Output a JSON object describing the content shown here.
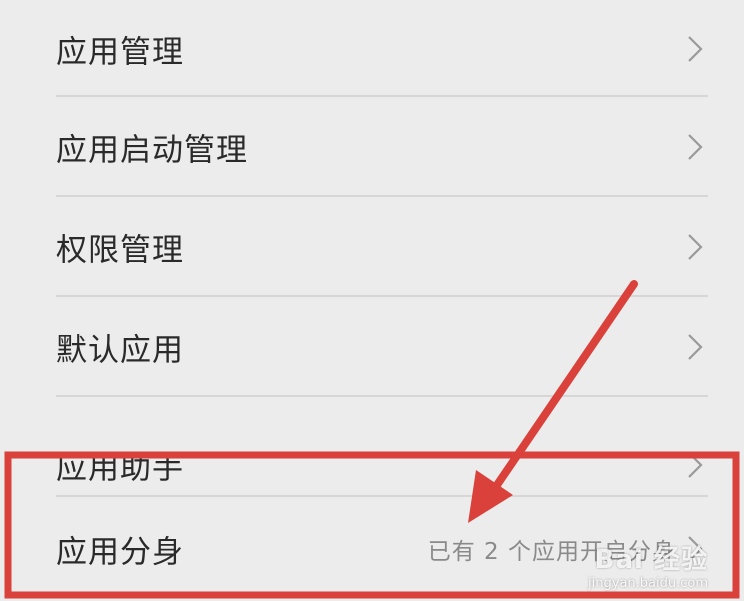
{
  "settings_list": {
    "items": [
      {
        "label": "应用管理",
        "value": ""
      },
      {
        "label": "应用启动管理",
        "value": ""
      },
      {
        "label": "权限管理",
        "value": ""
      },
      {
        "label": "默认应用",
        "value": ""
      },
      {
        "label": "应用助手",
        "value": ""
      },
      {
        "label": "应用分身",
        "value": "已有 2 个应用开启分身"
      }
    ]
  },
  "annotations": {
    "highlight_color": "#d9413a",
    "arrow_color": "#d9413a"
  },
  "watermark": {
    "brand": "Bai 经验",
    "url": "jingyan.baidu.com"
  },
  "icons": {
    "chevron": "chevron-right-icon"
  }
}
